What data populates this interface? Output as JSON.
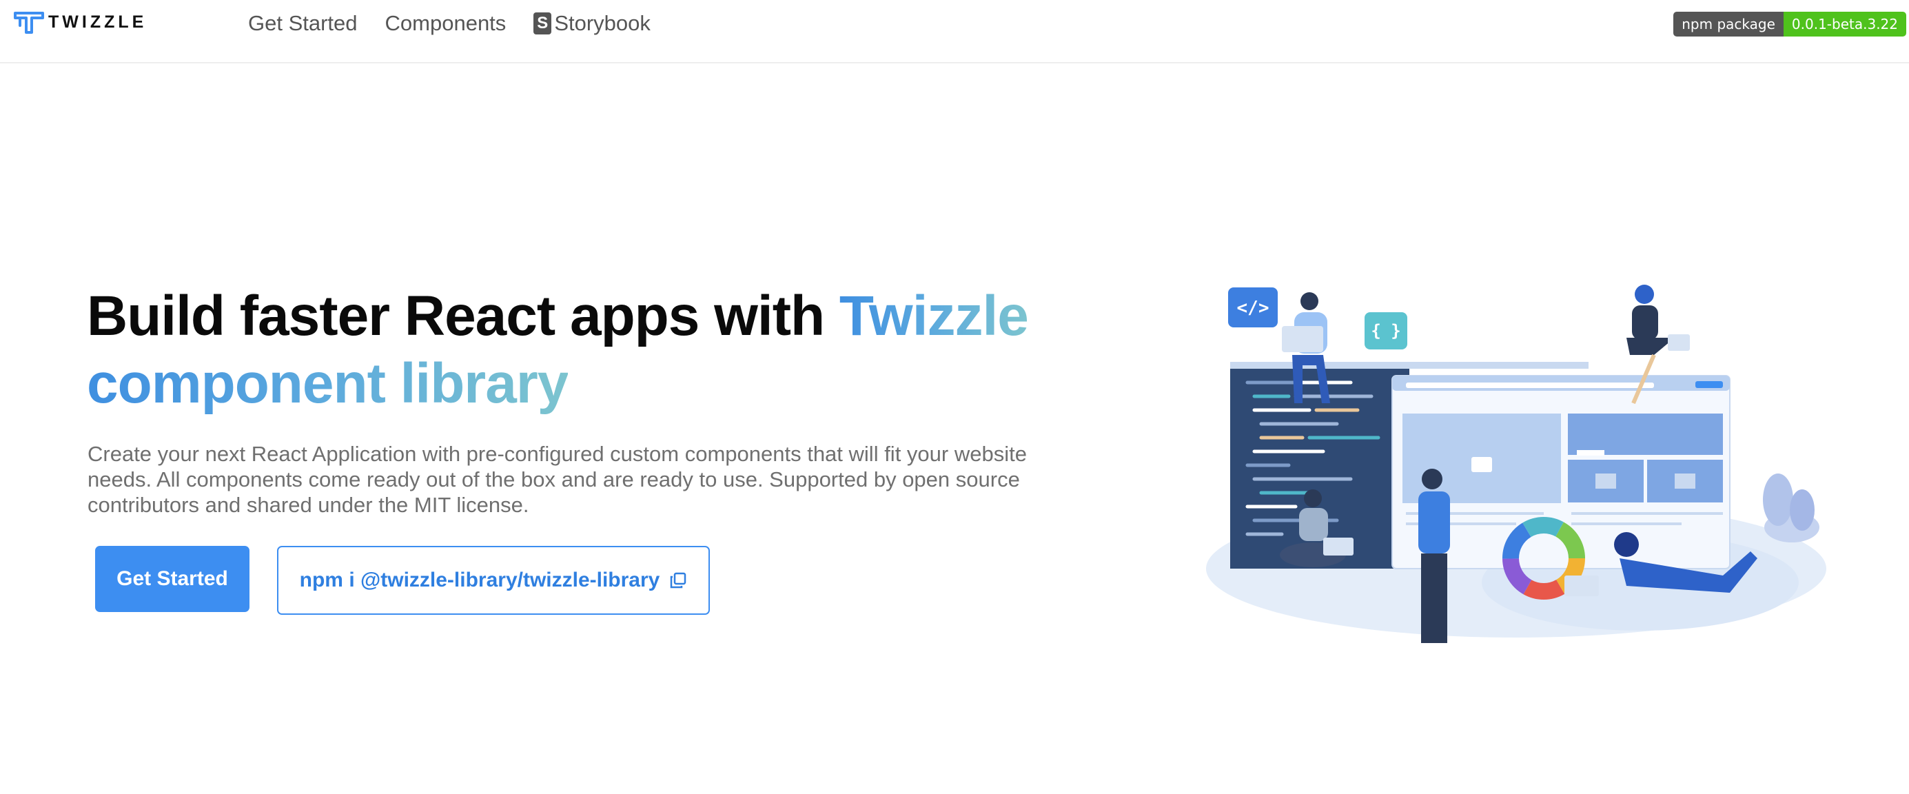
{
  "nav": {
    "logo_text": "TWIZZLE",
    "links": [
      {
        "label": "Get Started"
      },
      {
        "label": "Components"
      },
      {
        "label": "Storybook"
      }
    ],
    "storybook_icon_glyph": "S",
    "npm_badge": {
      "label": "npm package",
      "version": "0.0.1-beta.3.22"
    }
  },
  "hero": {
    "title_plain": "Build faster React apps with ",
    "title_accent_1": "Twizzle",
    "title_accent_2": "component library",
    "description": "Create your next React Application with pre-configured custom components that will fit your website needs. All components come ready out of the box and are ready to use. Supported by open source contributors and shared under the MIT license.",
    "primary_button": "Get Started",
    "install_command": "npm i @twizzle-library/twizzle-library"
  },
  "illustration": {
    "code_badge": "</>",
    "json_badge": "{ }"
  },
  "colors": {
    "brand_blue": "#3d8ef1",
    "accent_teal": "#7cc4cf",
    "badge_green": "#4fc21c",
    "badge_gray": "#555555"
  },
  "icons": [
    "twizzle-logo-icon",
    "storybook-icon",
    "copy-icon"
  ]
}
